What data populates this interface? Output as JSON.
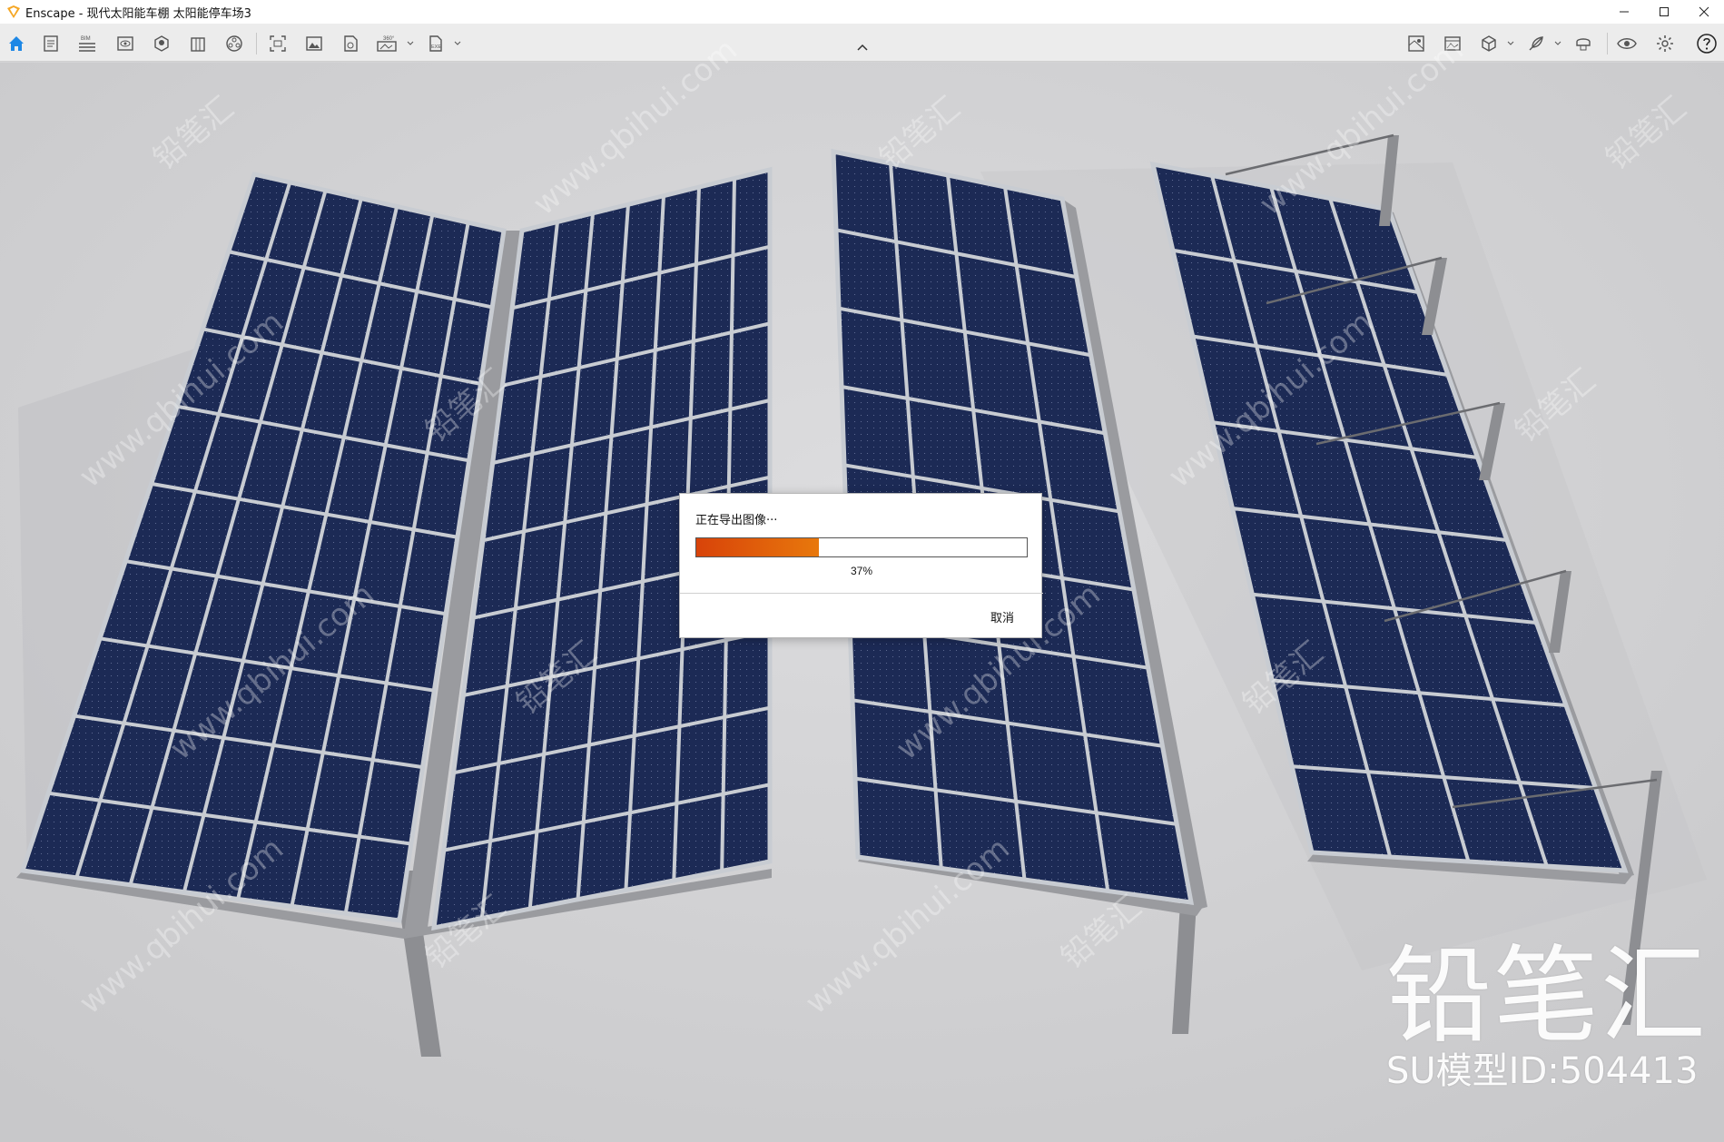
{
  "window": {
    "app_name": "Enscape",
    "title": "Enscape - 现代太阳能车棚 太阳能停车场3",
    "controls": [
      "minimize",
      "maximize",
      "close"
    ]
  },
  "toolbar": {
    "left_buttons": [
      {
        "name": "home",
        "icon": "home-icon"
      },
      {
        "name": "project",
        "icon": "document-icon"
      },
      {
        "name": "bim",
        "icon": "bim-icon",
        "label": "BIM"
      },
      {
        "name": "views",
        "icon": "eye-box-icon"
      },
      {
        "name": "assets",
        "icon": "asset-icon"
      },
      {
        "name": "materials",
        "icon": "building-icon"
      },
      {
        "name": "atmosphere",
        "icon": "sphere-icon"
      },
      {
        "name": "capture",
        "icon": "capture-icon"
      },
      {
        "name": "screenshot",
        "icon": "image-icon"
      },
      {
        "name": "batch",
        "icon": "batch-icon"
      },
      {
        "name": "panorama",
        "icon": "panorama-icon",
        "label": "360°"
      },
      {
        "name": "export",
        "icon": "export-icon",
        "label": "EXE"
      }
    ],
    "right_buttons": [
      {
        "name": "minimap",
        "icon": "map-icon"
      },
      {
        "name": "render",
        "icon": "render-icon"
      },
      {
        "name": "cube",
        "icon": "cube-icon"
      },
      {
        "name": "feather",
        "icon": "feather-icon"
      },
      {
        "name": "vr",
        "icon": "vr-icon"
      },
      {
        "name": "visual-settings",
        "icon": "eye-icon"
      },
      {
        "name": "settings",
        "icon": "gear-icon"
      },
      {
        "name": "help",
        "icon": "help-icon"
      }
    ]
  },
  "dialog": {
    "title": "正在导出图像···",
    "progress_value": 0.37,
    "progress_text": "37%",
    "cancel_label": "取消",
    "progress_color": "#e06010"
  },
  "watermark": {
    "brand": "铅笔汇",
    "model_id": "SU模型ID:504413",
    "tile_text": "铅笔汇",
    "tile_url": "www.qbihui.com"
  },
  "colors": {
    "panel": "#1c2a55",
    "panel_grid": "#c8ccd2",
    "frame": "#8d8e92",
    "ground": "#d4d4d6"
  }
}
